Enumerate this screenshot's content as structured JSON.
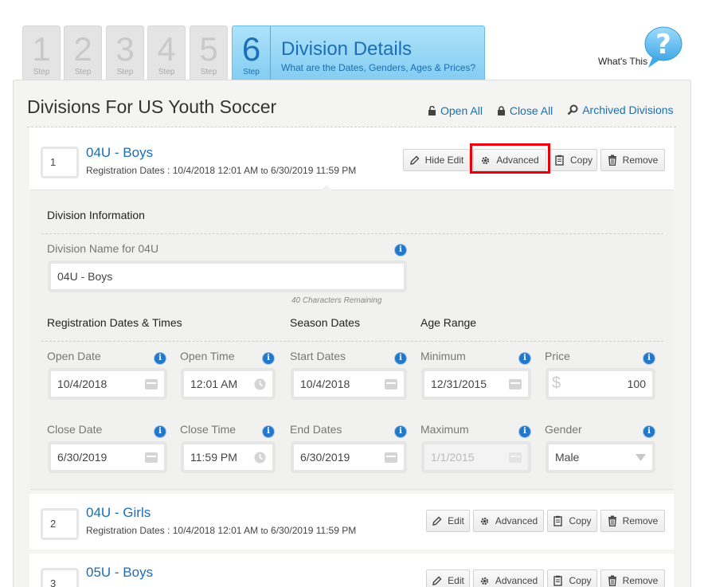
{
  "steps": [
    {
      "num": "1",
      "label": "Step"
    },
    {
      "num": "2",
      "label": "Step"
    },
    {
      "num": "3",
      "label": "Step"
    },
    {
      "num": "4",
      "label": "Step"
    },
    {
      "num": "5",
      "label": "Step"
    }
  ],
  "active_step": {
    "num": "6",
    "label": "Step",
    "title": "Division Details",
    "subtitle": "What are the Dates, Genders, Ages & Prices?"
  },
  "whats_this": "What's This",
  "page_title": "Divisions For US Youth Soccer",
  "links": {
    "open_all": "Open All",
    "close_all": "Close All",
    "archived": "Archived Divisions"
  },
  "divisions": [
    {
      "order": "1",
      "name": "04U - Boys",
      "dates_prefix": "Registration Dates : 10/4/2018 12:01 AM",
      "to": "to",
      "dates_suffix": "6/30/2019 11:59 PM"
    },
    {
      "order": "2",
      "name": "04U - Girls",
      "dates_prefix": "Registration Dates : 10/4/2018 12:01 AM",
      "to": "to",
      "dates_suffix": "6/30/2019 11:59 PM"
    },
    {
      "order": "3",
      "name": "05U - Boys"
    }
  ],
  "buttons": {
    "hide_edit": "Hide Edit",
    "edit": "Edit",
    "advanced": "Advanced",
    "copy": "Copy",
    "remove": "Remove"
  },
  "form": {
    "section_title": "Division Information",
    "name_label": "Division Name for 04U",
    "name_value": "04U - Boys",
    "remaining": "40 Characters Remaining",
    "reg_heading": "Registration Dates & Times",
    "season_heading": "Season Dates",
    "age_heading": "Age Range",
    "open_date_label": "Open Date",
    "open_date": "10/4/2018",
    "open_time_label": "Open Time",
    "open_time": "12:01 AM",
    "start_label": "Start Dates",
    "start_date": "10/4/2018",
    "min_label": "Minimum",
    "min_value": "12/31/2015",
    "price_label": "Price",
    "currency": "$",
    "price": "100",
    "close_date_label": "Close Date",
    "close_date": "6/30/2019",
    "close_time_label": "Close Time",
    "close_time": "11:59 PM",
    "end_label": "End Dates",
    "end_date": "6/30/2019",
    "max_label": "Maximum",
    "max_value": "1/1/2015",
    "gender_label": "Gender",
    "gender": "Male"
  },
  "colors": {
    "accent": "#1a6fb5",
    "highlight": "#e8000b",
    "info": "#2577c8"
  }
}
